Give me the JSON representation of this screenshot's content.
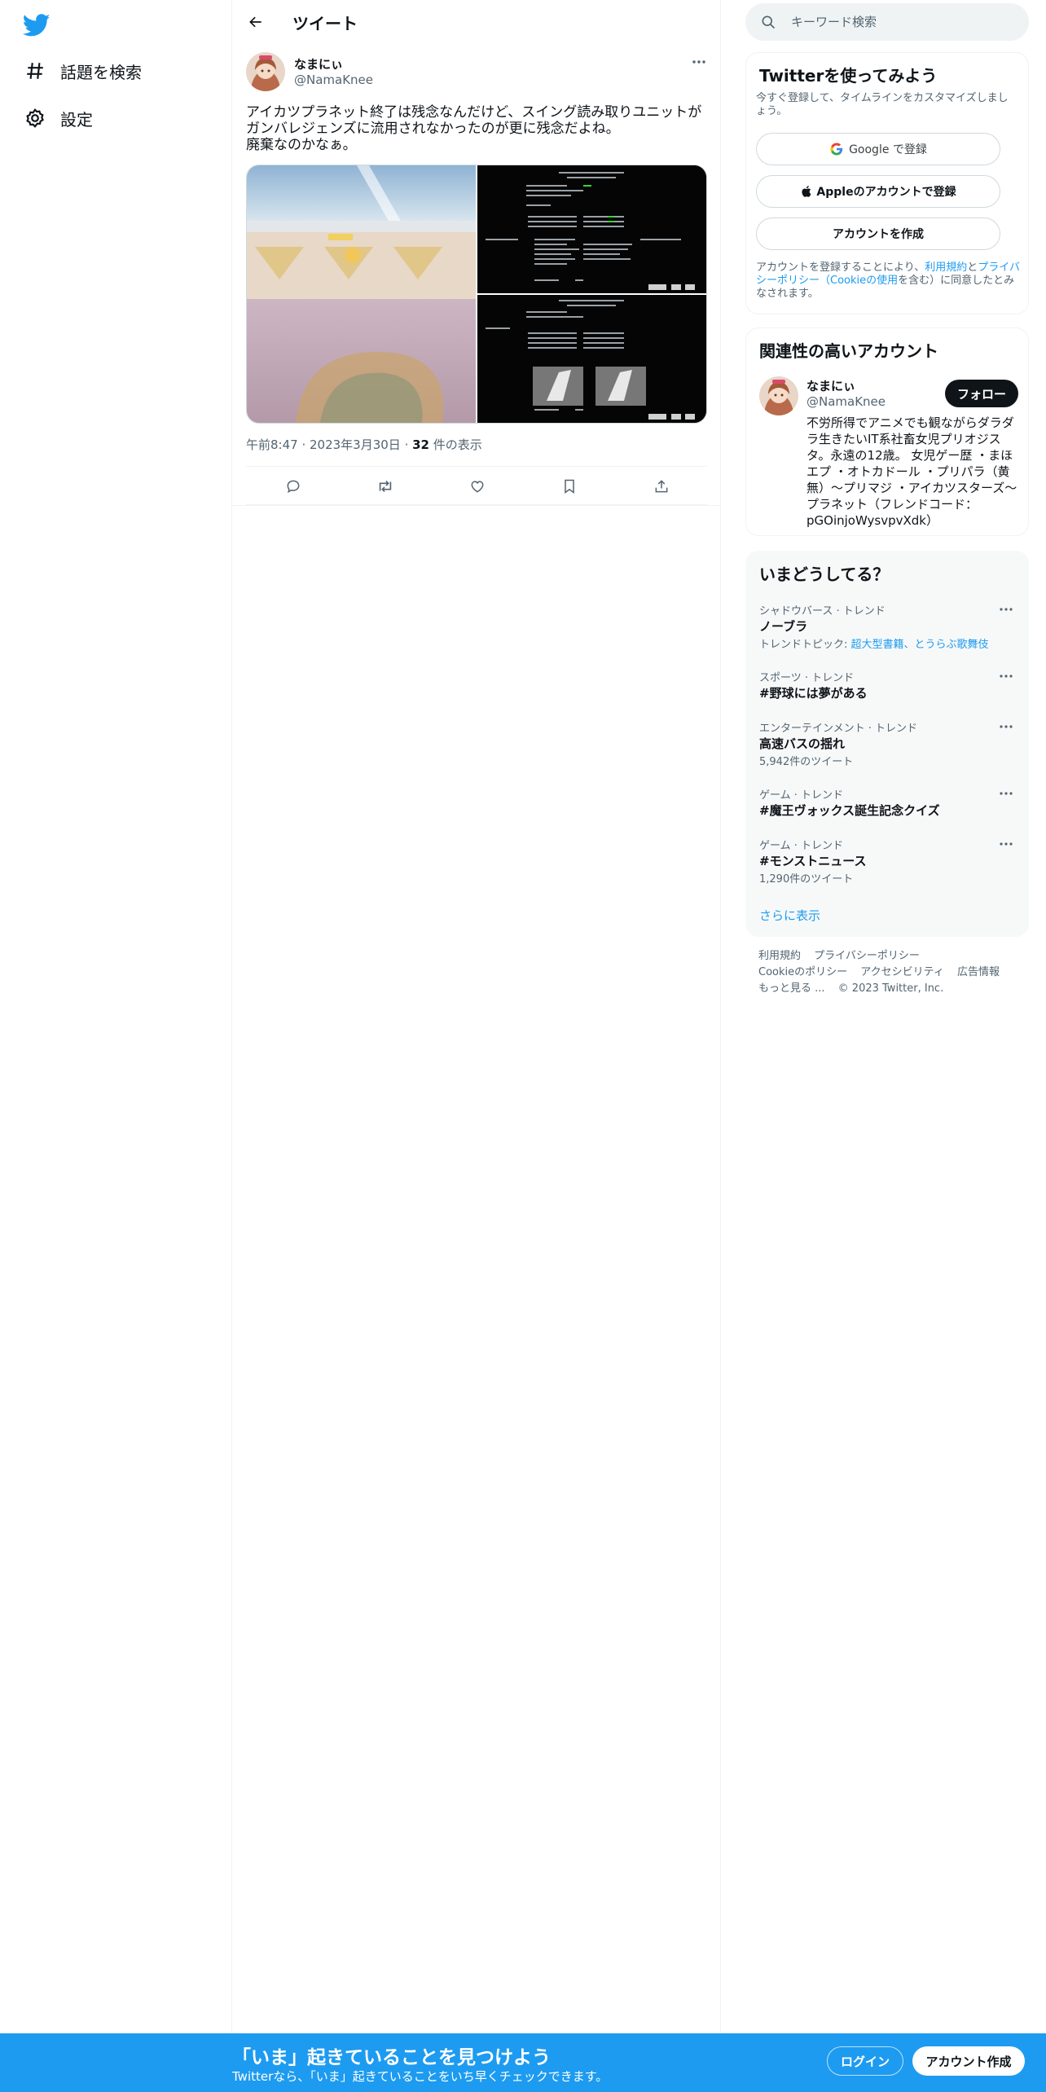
{
  "nav": {
    "explore_label": "話題を検索",
    "settings_label": "設定"
  },
  "header": {
    "title": "ツイート"
  },
  "tweet": {
    "author_name": "なまにぃ",
    "author_handle": "@NamaKnee",
    "text": "アイカツプラネット終了は残念なんだけど、スイング読み取りユニットが\nガンバレジェンズに流用されなかったのが更に残念だよね。\n廃棄なのかなぁ。",
    "time": "午前8:47",
    "date": "2023年3月30日",
    "views_count": "32",
    "views_label": "件の表示"
  },
  "search": {
    "placeholder": "キーワード検索"
  },
  "signup_card": {
    "title": "Twitterを使ってみよう",
    "subtitle": "今すぐ登録して、タイムラインをカスタマイズしましょう。",
    "google_label": "Google で登録",
    "apple_label": "Appleのアカウントで登録",
    "create_label": "アカウントを作成",
    "legal_prefix": "アカウントを登録することにより、",
    "terms_link": "利用規約",
    "and": "と",
    "privacy_link": "プライバシーポリシー",
    "cookie_link": "（Cookieの使用",
    "legal_suffix": "を含む）に同意したとみなされます。"
  },
  "related_card": {
    "title": "関連性の高いアカウント",
    "name": "なまにぃ",
    "handle": "@NamaKnee",
    "follow_label": "フォロー",
    "bio": "不労所得でアニメでも観ながらダラダラ生きたいIT系社畜女児プリオジスタ。永遠の12歳。 女児ゲー歴 ・まほエプ ・オトカドール ・プリパラ（黄無）〜プリマジ ・アイカツスターズ〜プラネット（フレンドコード：pGOinjoWysvpvXdk）"
  },
  "trends_card": {
    "title": "いまどうしてる？",
    "items": [
      {
        "category": "シャドウバース · トレンド",
        "name": "ノーブラ",
        "sub_prefix": "トレンドトピック: ",
        "sub_link": "超大型書籍、とうらぶ歌舞伎"
      },
      {
        "category": "スポーツ · トレンド",
        "name": "#野球には夢がある",
        "sub": ""
      },
      {
        "category": "エンターテインメント · トレンド",
        "name": "高速バスの揺れ",
        "sub": "5,942件のツイート"
      },
      {
        "category": "ゲーム · トレンド",
        "name": "#魔王ヴォックス誕生記念クイズ",
        "sub": ""
      },
      {
        "category": "ゲーム · トレンド",
        "name": "#モンストニュース",
        "sub": "1,290件のツイート"
      }
    ],
    "show_more": "さらに表示"
  },
  "footer": {
    "terms": "利用規約",
    "privacy": "プライバシーポリシー",
    "cookie": "Cookieのポリシー",
    "accessibility": "アクセシビリティ",
    "ads": "広告情報",
    "more": "もっと見る ...",
    "copyright": "© 2023 Twitter, Inc."
  },
  "bottom_bar": {
    "title": "「いま」起きていることを見つけよう",
    "subtitle": "Twitterなら、「いま」起きていることをいち早くチェックできます。",
    "login_label": "ログイン",
    "signup_label": "アカウント作成"
  },
  "colors": {
    "brand": "#1d9bf0",
    "text": "#0f1419",
    "muted": "#536471"
  }
}
